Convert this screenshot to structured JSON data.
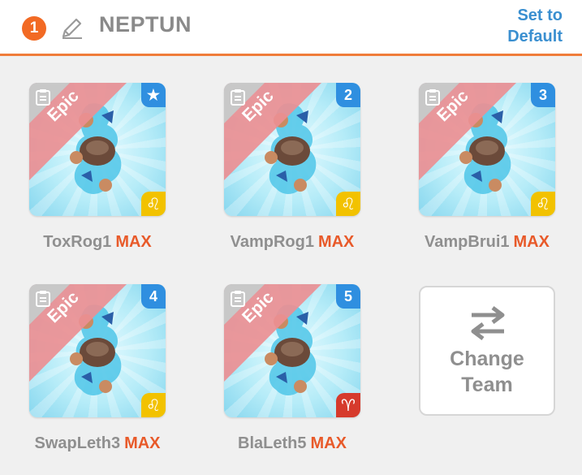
{
  "header": {
    "badge": "1",
    "team_name": "NEPTUN",
    "set_default_label": "Set to\nDefault"
  },
  "heroes": [
    {
      "name": "ToxRog1",
      "level": "MAX",
      "tier": "Epic",
      "rank": "★",
      "sign": "♌",
      "sign_color": "#f2c200"
    },
    {
      "name": "VampRog1",
      "level": "MAX",
      "tier": "Epic",
      "rank": "2",
      "sign": "♌",
      "sign_color": "#f2c200"
    },
    {
      "name": "VampBrui1",
      "level": "MAX",
      "tier": "Epic",
      "rank": "3",
      "sign": "♌",
      "sign_color": "#f2c200"
    },
    {
      "name": "SwapLeth3",
      "level": "MAX",
      "tier": "Epic",
      "rank": "4",
      "sign": "♌",
      "sign_color": "#f2c200"
    },
    {
      "name": "BlaLeth5",
      "level": "MAX",
      "tier": "Epic",
      "rank": "5",
      "sign": "♈",
      "sign_color": "#d63a2c"
    }
  ],
  "change_team": {
    "label": "Change\nTeam",
    "icon": "swap-arrows-icon"
  },
  "colors": {
    "accent": "#f26a24",
    "link": "#3a8fd0",
    "max": "#e85a2a",
    "rank_badge": "#2f8fe0"
  }
}
